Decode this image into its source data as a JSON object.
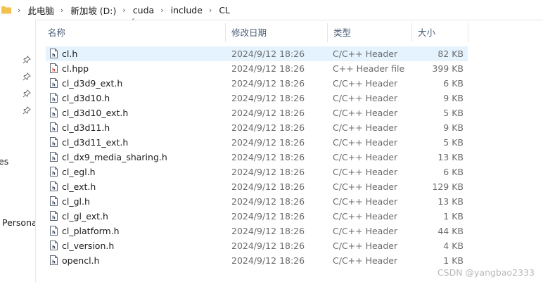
{
  "breadcrumb": [
    "此电脑",
    "新加坡 (D:)",
    "cuda",
    "include",
    "CL"
  ],
  "nav": {
    "items": [
      "es",
      "Persona"
    ]
  },
  "columns": {
    "name": "名称",
    "date": "修改日期",
    "type": "类型",
    "size": "大小"
  },
  "files": [
    {
      "name": "cl.h",
      "date": "2024/9/12 18:26",
      "type": "C/C++ Header",
      "size": "82 KB"
    },
    {
      "name": "cl.hpp",
      "date": "2024/9/12 18:26",
      "type": "C++ Header file",
      "size": "399 KB"
    },
    {
      "name": "cl_d3d9_ext.h",
      "date": "2024/9/12 18:26",
      "type": "C/C++ Header",
      "size": "6 KB"
    },
    {
      "name": "cl_d3d10.h",
      "date": "2024/9/12 18:26",
      "type": "C/C++ Header",
      "size": "9 KB"
    },
    {
      "name": "cl_d3d10_ext.h",
      "date": "2024/9/12 18:26",
      "type": "C/C++ Header",
      "size": "5 KB"
    },
    {
      "name": "cl_d3d11.h",
      "date": "2024/9/12 18:26",
      "type": "C/C++ Header",
      "size": "9 KB"
    },
    {
      "name": "cl_d3d11_ext.h",
      "date": "2024/9/12 18:26",
      "type": "C/C++ Header",
      "size": "5 KB"
    },
    {
      "name": "cl_dx9_media_sharing.h",
      "date": "2024/9/12 18:26",
      "type": "C/C++ Header",
      "size": "13 KB"
    },
    {
      "name": "cl_egl.h",
      "date": "2024/9/12 18:26",
      "type": "C/C++ Header",
      "size": "6 KB"
    },
    {
      "name": "cl_ext.h",
      "date": "2024/9/12 18:26",
      "type": "C/C++ Header",
      "size": "129 KB"
    },
    {
      "name": "cl_gl.h",
      "date": "2024/9/12 18:26",
      "type": "C/C++ Header",
      "size": "13 KB"
    },
    {
      "name": "cl_gl_ext.h",
      "date": "2024/9/12 18:26",
      "type": "C/C++ Header",
      "size": "1 KB"
    },
    {
      "name": "cl_platform.h",
      "date": "2024/9/12 18:26",
      "type": "C/C++ Header",
      "size": "44 KB"
    },
    {
      "name": "cl_version.h",
      "date": "2024/9/12 18:26",
      "type": "C/C++ Header",
      "size": "4 KB"
    },
    {
      "name": "opencl.h",
      "date": "2024/9/12 18:26",
      "type": "C/C++ Header",
      "size": "1 KB"
    }
  ],
  "selected_file": "cl.h",
  "watermark": "CSDN @yangbao2333",
  "colors": {
    "selection": "#e5f3ff",
    "header_text": "#4c607a",
    "folder": "#f2c24f"
  }
}
